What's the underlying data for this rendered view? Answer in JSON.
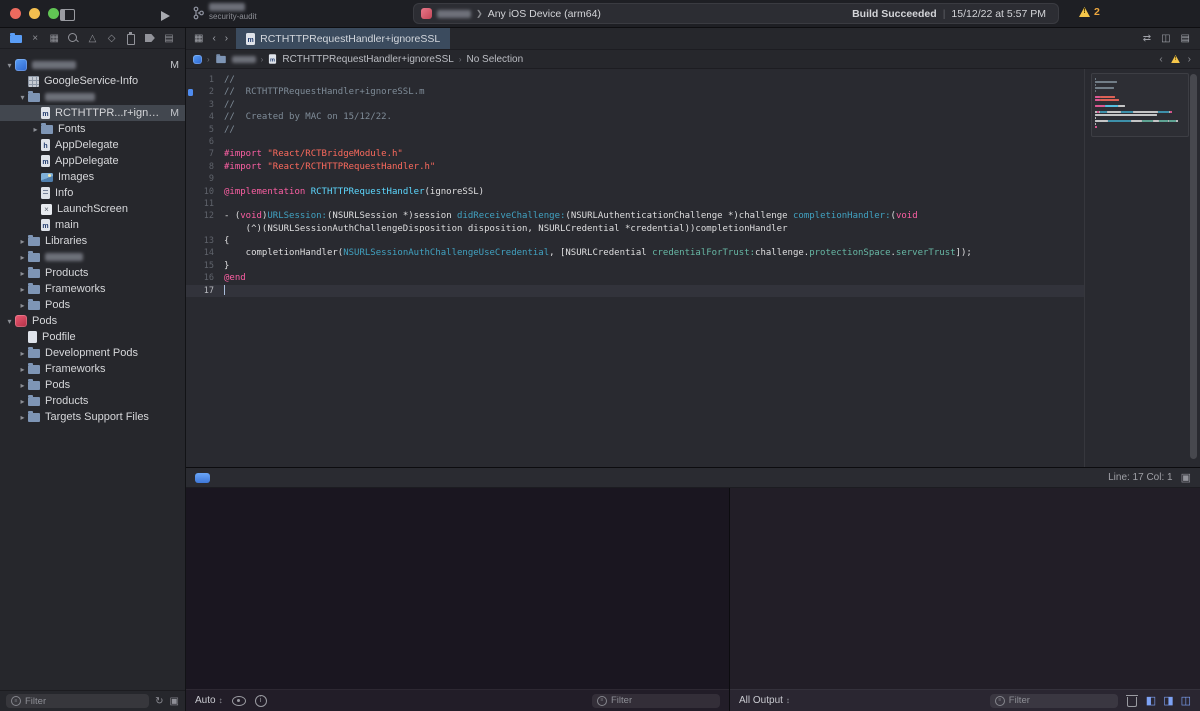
{
  "toolbar": {
    "branch_secondary": "security-audit",
    "destination": "Any iOS Device (arm64)",
    "destination_chevron": "❯",
    "build_status": "Build Succeeded",
    "status_separator": "|",
    "build_time": "15/12/22 at 5:57 PM",
    "warning_count": "2"
  },
  "tabbar": {
    "tab": {
      "label": "RCTHTTPRequestHandler+ignoreSSL",
      "icon_letter": "m"
    },
    "left_icons": [
      {
        "name": "related-items-icon",
        "glyph": "▦"
      },
      {
        "name": "go-back-icon",
        "glyph": "‹"
      },
      {
        "name": "go-forward-icon",
        "glyph": "›"
      }
    ],
    "right_icons": [
      {
        "name": "code-review-icon",
        "glyph": "⇄"
      },
      {
        "name": "add-editor-icon",
        "glyph": "◫"
      },
      {
        "name": "editor-options-icon",
        "glyph": "▤"
      }
    ]
  },
  "jumpbar": {
    "file": "RCTHTTPRequestHandler+ignoreSSL",
    "file_icon_letter": "m",
    "selection": "No Selection",
    "chevron": "›"
  },
  "sidebar": {
    "navigators": [
      {
        "name": "project-navigator-icon",
        "glyph": "folder",
        "active": true
      },
      {
        "name": "source-control-navigator-icon",
        "glyph": "×"
      },
      {
        "name": "symbol-navigator-icon",
        "glyph": "▦"
      },
      {
        "name": "find-navigator-icon",
        "glyph": "mag"
      },
      {
        "name": "issue-navigator-icon",
        "glyph": "△"
      },
      {
        "name": "test-navigator-icon",
        "glyph": "◇"
      },
      {
        "name": "debug-navigator-icon",
        "glyph": "spray"
      },
      {
        "name": "breakpoint-navigator-icon",
        "glyph": "tag"
      },
      {
        "name": "report-navigator-icon",
        "glyph": "▤"
      }
    ],
    "tree": [
      {
        "depth": 0,
        "chevron": "expanded",
        "icon": "project",
        "redacted": true,
        "redacted_width": 44,
        "badge": "M"
      },
      {
        "depth": 1,
        "icon": "plist",
        "label": "GoogleService-Info"
      },
      {
        "depth": 1,
        "chevron": "expanded",
        "icon": "folder",
        "redacted": true,
        "redacted_width": 50
      },
      {
        "depth": 2,
        "icon": "file-m",
        "label": "RCTHTTPR...r+ignoreSSL",
        "badge": "M",
        "selected": true
      },
      {
        "depth": 2,
        "chevron": "collapsed",
        "icon": "folder",
        "label": "Fonts"
      },
      {
        "depth": 2,
        "icon": "file-h",
        "label": "AppDelegate"
      },
      {
        "depth": 2,
        "icon": "file-m",
        "label": "AppDelegate"
      },
      {
        "depth": 2,
        "icon": "images",
        "label": "Images"
      },
      {
        "depth": 2,
        "icon": "info",
        "label": "Info"
      },
      {
        "depth": 2,
        "icon": "storyboard",
        "label": "LaunchScreen"
      },
      {
        "depth": 2,
        "icon": "file-m",
        "label": "main"
      },
      {
        "depth": 1,
        "chevron": "collapsed",
        "icon": "folder",
        "label": "Libraries"
      },
      {
        "depth": 1,
        "chevron": "collapsed",
        "icon": "folder",
        "redacted": true,
        "redacted_width": 38
      },
      {
        "depth": 1,
        "chevron": "collapsed",
        "icon": "folder",
        "label": "Products"
      },
      {
        "depth": 1,
        "chevron": "collapsed",
        "icon": "folder",
        "label": "Frameworks"
      },
      {
        "depth": 1,
        "chevron": "collapsed",
        "icon": "folder",
        "label": "Pods"
      },
      {
        "depth": 0,
        "chevron": "expanded",
        "icon": "pods",
        "label": "Pods"
      },
      {
        "depth": 1,
        "icon": "podfile",
        "label": "Podfile"
      },
      {
        "depth": 1,
        "chevron": "collapsed",
        "icon": "folder",
        "label": "Development Pods"
      },
      {
        "depth": 1,
        "chevron": "collapsed",
        "icon": "folder",
        "label": "Frameworks"
      },
      {
        "depth": 1,
        "chevron": "collapsed",
        "icon": "folder",
        "label": "Pods"
      },
      {
        "depth": 1,
        "chevron": "collapsed",
        "icon": "folder",
        "label": "Products"
      },
      {
        "depth": 1,
        "chevron": "collapsed",
        "icon": "folder",
        "label": "Targets Support Files"
      }
    ],
    "filter_placeholder": "Filter",
    "filter_icons": [
      {
        "name": "recent-files-icon",
        "glyph": "↻"
      },
      {
        "name": "scm-status-filter-icon",
        "glyph": "▣"
      }
    ]
  },
  "editor": {
    "palette": {
      "plain": "#dfdfe0",
      "comment": "#7f8c98",
      "keyword": "#fc5fa3",
      "string": "#fc6a5d",
      "type": "#5dd8ff",
      "method": "#41a1c0",
      "member": "#67b7a4"
    },
    "current_line": 17,
    "lines": [
      {
        "num": "1",
        "tokens": [
          [
            "c",
            "//"
          ]
        ]
      },
      {
        "num": "2",
        "marker": true,
        "tokens": [
          [
            "c",
            "//  RCTHTTPRequestHandler+ignoreSSL.m"
          ]
        ]
      },
      {
        "num": "3",
        "tokens": [
          [
            "c",
            "//"
          ]
        ]
      },
      {
        "num": "4",
        "tokens": [
          [
            "c",
            "//  Created by MAC on 15/12/22."
          ]
        ]
      },
      {
        "num": "5",
        "tokens": [
          [
            "c",
            "//"
          ]
        ]
      },
      {
        "num": "6",
        "tokens": []
      },
      {
        "num": "7",
        "tokens": [
          [
            "k",
            "#import "
          ],
          [
            "s",
            "\"React/RCTBridgeModule.h\""
          ]
        ]
      },
      {
        "num": "8",
        "tokens": [
          [
            "k",
            "#import "
          ],
          [
            "s",
            "\"React/RCTHTTPRequestHandler.h\""
          ]
        ]
      },
      {
        "num": "9",
        "tokens": []
      },
      {
        "num": "10",
        "tokens": [
          [
            "k",
            "@implementation "
          ],
          [
            "t",
            "RCTHTTPRequestHandler"
          ],
          [
            "p",
            "(ignoreSSL)"
          ]
        ]
      },
      {
        "num": "11",
        "tokens": []
      },
      {
        "num": "12",
        "tokens": [
          [
            "p",
            "- ("
          ],
          [
            "k",
            "void"
          ],
          [
            "p",
            ")"
          ],
          [
            "m",
            "URLSession:"
          ],
          [
            "p",
            "(NSURLSession *)session "
          ],
          [
            "m",
            "didReceiveChallenge:"
          ],
          [
            "p",
            "(NSURLAuthenticationChallenge *)challenge "
          ],
          [
            "m",
            "completionHandler:"
          ],
          [
            "p",
            "("
          ],
          [
            "k",
            "void"
          ]
        ]
      },
      {
        "num": "",
        "wrap": true,
        "tokens": [
          [
            "p",
            "    (^)(NSURLSessionAuthChallengeDisposition disposition, NSURLCredential *credential))completionHandler"
          ]
        ]
      },
      {
        "num": "13",
        "tokens": [
          [
            "p",
            "{"
          ]
        ]
      },
      {
        "num": "14",
        "tokens": [
          [
            "p",
            "    completionHandler("
          ],
          [
            "m",
            "NSURLSessionAuthChallengeUseCredential"
          ],
          [
            "p",
            ", [NSURLCredential "
          ],
          [
            "g",
            "credentialForTrust:"
          ],
          [
            "p",
            "challenge."
          ],
          [
            "g",
            "protectionSpace"
          ],
          [
            "p",
            "."
          ],
          [
            "g",
            "serverTrust"
          ],
          [
            "p",
            "]);"
          ]
        ]
      },
      {
        "num": "15",
        "tokens": [
          [
            "p",
            "}"
          ]
        ]
      },
      {
        "num": "16",
        "tokens": [
          [
            "k",
            "@end"
          ]
        ]
      },
      {
        "num": "17",
        "current": true,
        "tokens": []
      }
    ]
  },
  "debug": {
    "line_col": "Line: 17  Col: 1",
    "variables": {
      "scope_label": "Auto",
      "filter_placeholder": "Filter"
    },
    "console": {
      "output_label": "All Output",
      "filter_placeholder": "Filter",
      "icons": [
        {
          "name": "toggle-variables-view-icon",
          "glyph": "◧",
          "accent": true
        },
        {
          "name": "toggle-console-view-icon",
          "glyph": "◨",
          "accent": true
        },
        {
          "name": "debug-layout-icon",
          "glyph": "◫",
          "accent": true
        }
      ]
    }
  }
}
